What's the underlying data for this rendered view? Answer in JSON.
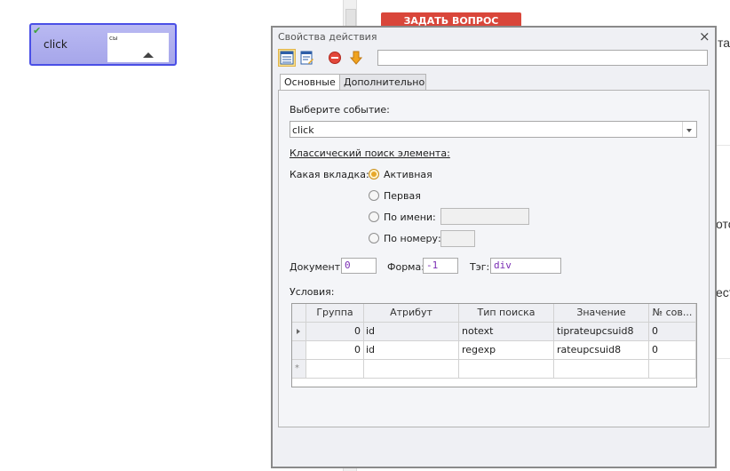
{
  "block": {
    "label": "click",
    "sub_text": "сы"
  },
  "background": {
    "red_button": "ЗАДАТЬ ВОПРОС",
    "frag1": "та",
    "frag2": "ото",
    "frag3": "ест"
  },
  "dialog": {
    "title": "Свойства действия",
    "close": "×",
    "tabs": [
      "Основные",
      "Дополнительно"
    ],
    "event_label": "Выберите событие:",
    "event_value": "click",
    "classic_search": "Классический поиск элемента:",
    "tab_question": "Какая вкладка:",
    "radio_options": [
      "Активная",
      "Первая",
      "По имени:",
      "По номеру:"
    ],
    "document_label": "Документ:",
    "document_value": "0",
    "form_label": "Форма:",
    "form_value": "-1",
    "tag_label": "Тэг:",
    "tag_value": "div",
    "conditions_label": "Условия:",
    "grid": {
      "columns": [
        "Группа",
        "Атрибут",
        "Тип поиска",
        "Значение",
        "№ сов..."
      ],
      "rows": [
        [
          "0",
          "id",
          "notext",
          "tiprateupcsuid8",
          "0"
        ],
        [
          "0",
          "id",
          "regexp",
          "rateupcsuid8",
          "0"
        ]
      ],
      "new_row_marker": "*"
    }
  },
  "colors": {
    "accent": "#4a4fe6",
    "radio_active": "#e7a82a",
    "field_text": "#7a2db4",
    "red_button": "#d9463a"
  }
}
